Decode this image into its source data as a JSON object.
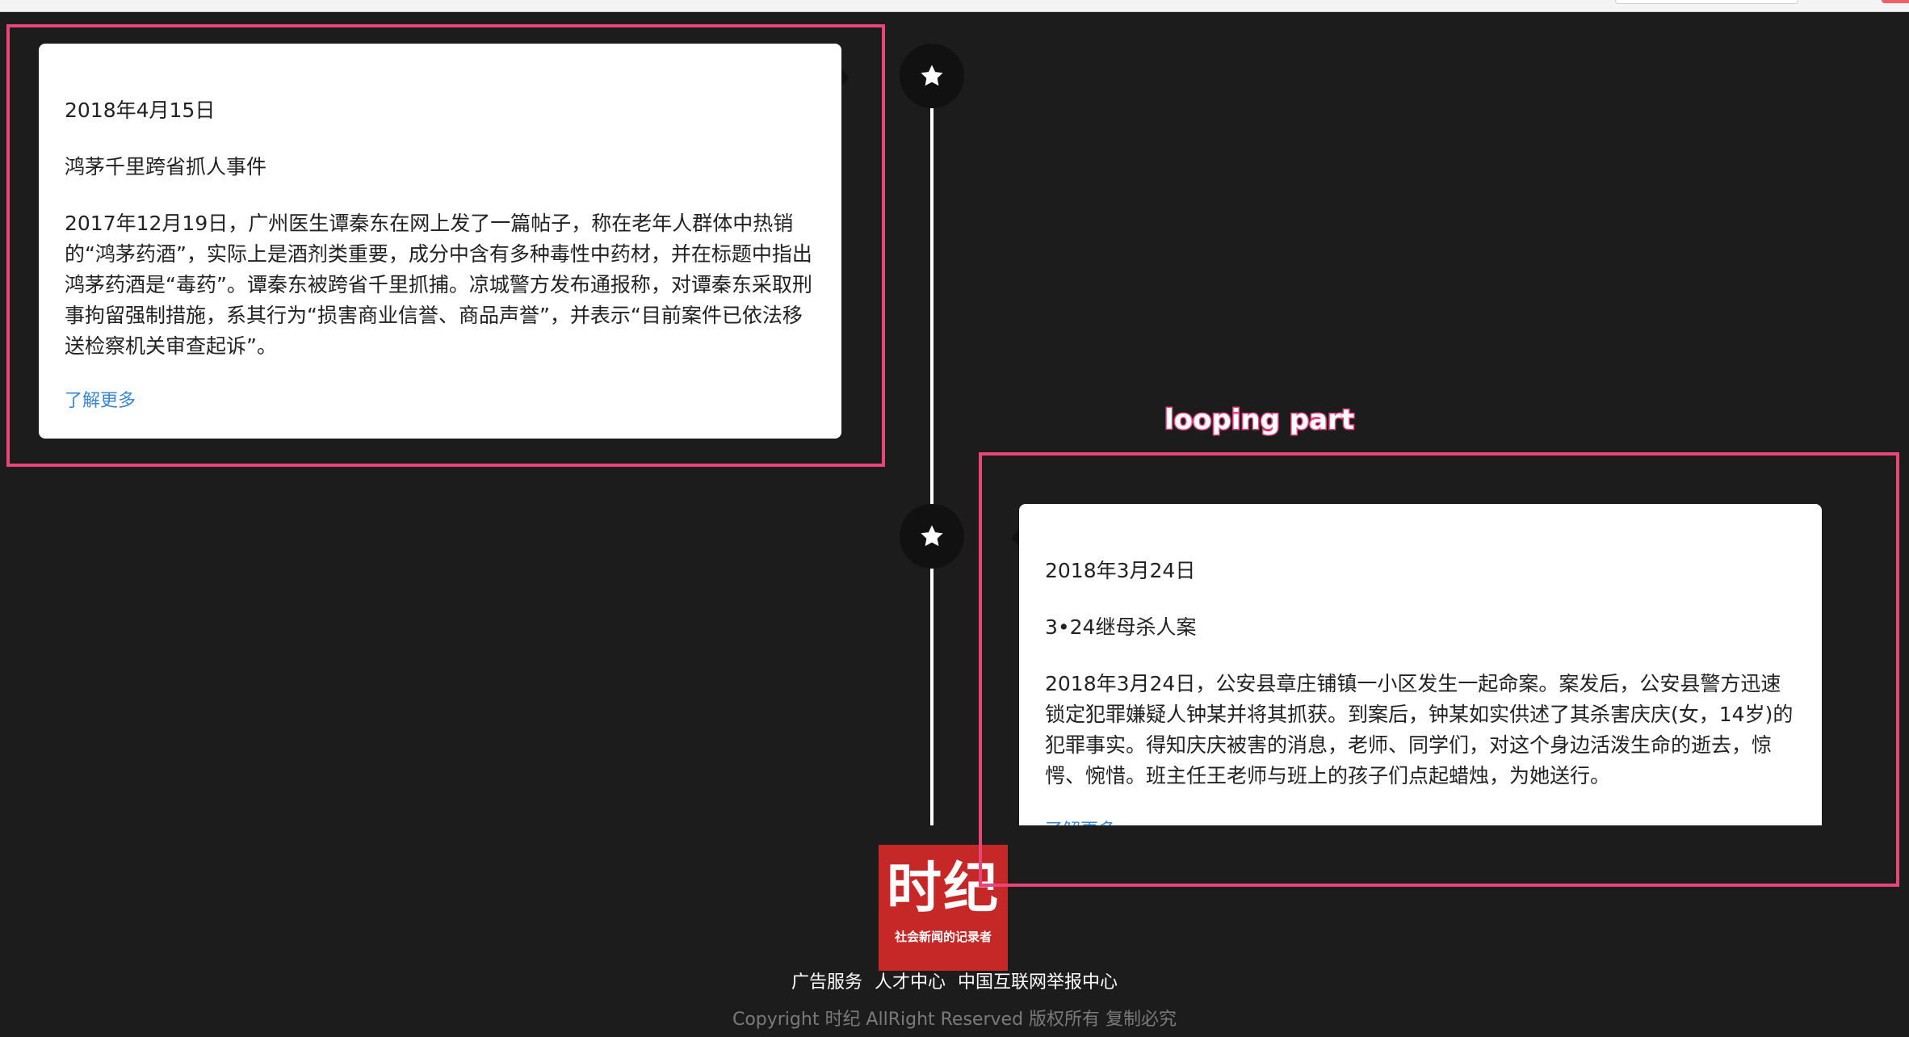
{
  "timeline": {
    "events": [
      {
        "date": "2018年4月15日",
        "title": "鸿茅千里跨省抓人事件",
        "body": "2017年12月19日，广州医生谭秦东在网上发了一篇帖子，称在老年人群体中热销的“鸿茅药酒”，实际上是酒剂类重要，成分中含有多种毒性中药材，并在标题中指出鸿茅药酒是“毒药”。谭秦东被跨省千里抓捕。凉城警方发布通报称，对谭秦东采取刑事拘留强制措施，系其行为“损害商业信誉、商品声誉”，并表示“目前案件已依法移送检察机关审查起诉”。",
        "more": "了解更多"
      },
      {
        "date": "2018年3月24日",
        "title": "3•24继母杀人案",
        "body": "2018年3月24日，公安县章庄铺镇一小区发生一起命案。案发后，公安县警方迅速锁定犯罪嫌疑人钟某并将其抓获。到案后，钟某如实供述了其杀害庆庆(女，14岁)的犯罪事实。得知庆庆被害的消息，老师、同学们，对这个身边活泼生命的逝去，惊愕、惋惜。班主任王老师与班上的孩子们点起蜡烛，为她送行。",
        "more": "了解更多"
      }
    ],
    "node_icon": "star-icon"
  },
  "annotation": {
    "label": "looping part",
    "color": "#e8457a"
  },
  "footer": {
    "logo": {
      "big": "时纪",
      "small": "社会新闻的记录者",
      "color": "#c62828"
    },
    "links": [
      "广告服务",
      "人才中心",
      "中国互联网举报中心"
    ],
    "copyright": "Copyright 时纪 AllRight Reserved 版权所有 复制必究"
  },
  "colors": {
    "background": "#1c1c1c",
    "link": "#3a86d1",
    "card": "#ffffff"
  }
}
